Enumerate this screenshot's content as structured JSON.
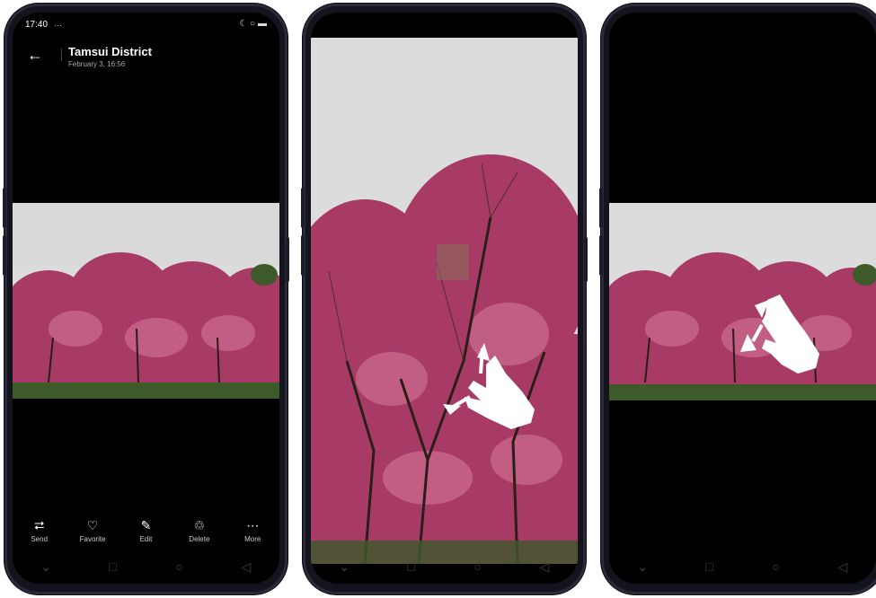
{
  "status": {
    "time": "17:40",
    "signal": "…",
    "right_icons": "☾ ○ ▬"
  },
  "header": {
    "back_label": "←",
    "title": "Tamsui District",
    "subtitle": "February 3, 16:56"
  },
  "toolbar": {
    "items": [
      {
        "icon": "share-icon",
        "glyph": "⮂",
        "label": "Send"
      },
      {
        "icon": "heart-icon",
        "glyph": "♡",
        "label": "Favorite"
      },
      {
        "icon": "edit-icon",
        "glyph": "✎",
        "label": "Edit"
      },
      {
        "icon": "trash-icon",
        "glyph": "♲",
        "label": "Delete"
      },
      {
        "icon": "more-icon",
        "glyph": "⋯",
        "label": "More"
      }
    ]
  },
  "navbar": {
    "down": "⌄",
    "recents": "□",
    "home": "○",
    "back": "◁"
  },
  "colors": {
    "sky": "#dcdcdc",
    "blossom": "#a83a66",
    "blossom_light": "#cd6d92",
    "trunk": "#2a1f18",
    "grass": "#3c5a2a"
  }
}
